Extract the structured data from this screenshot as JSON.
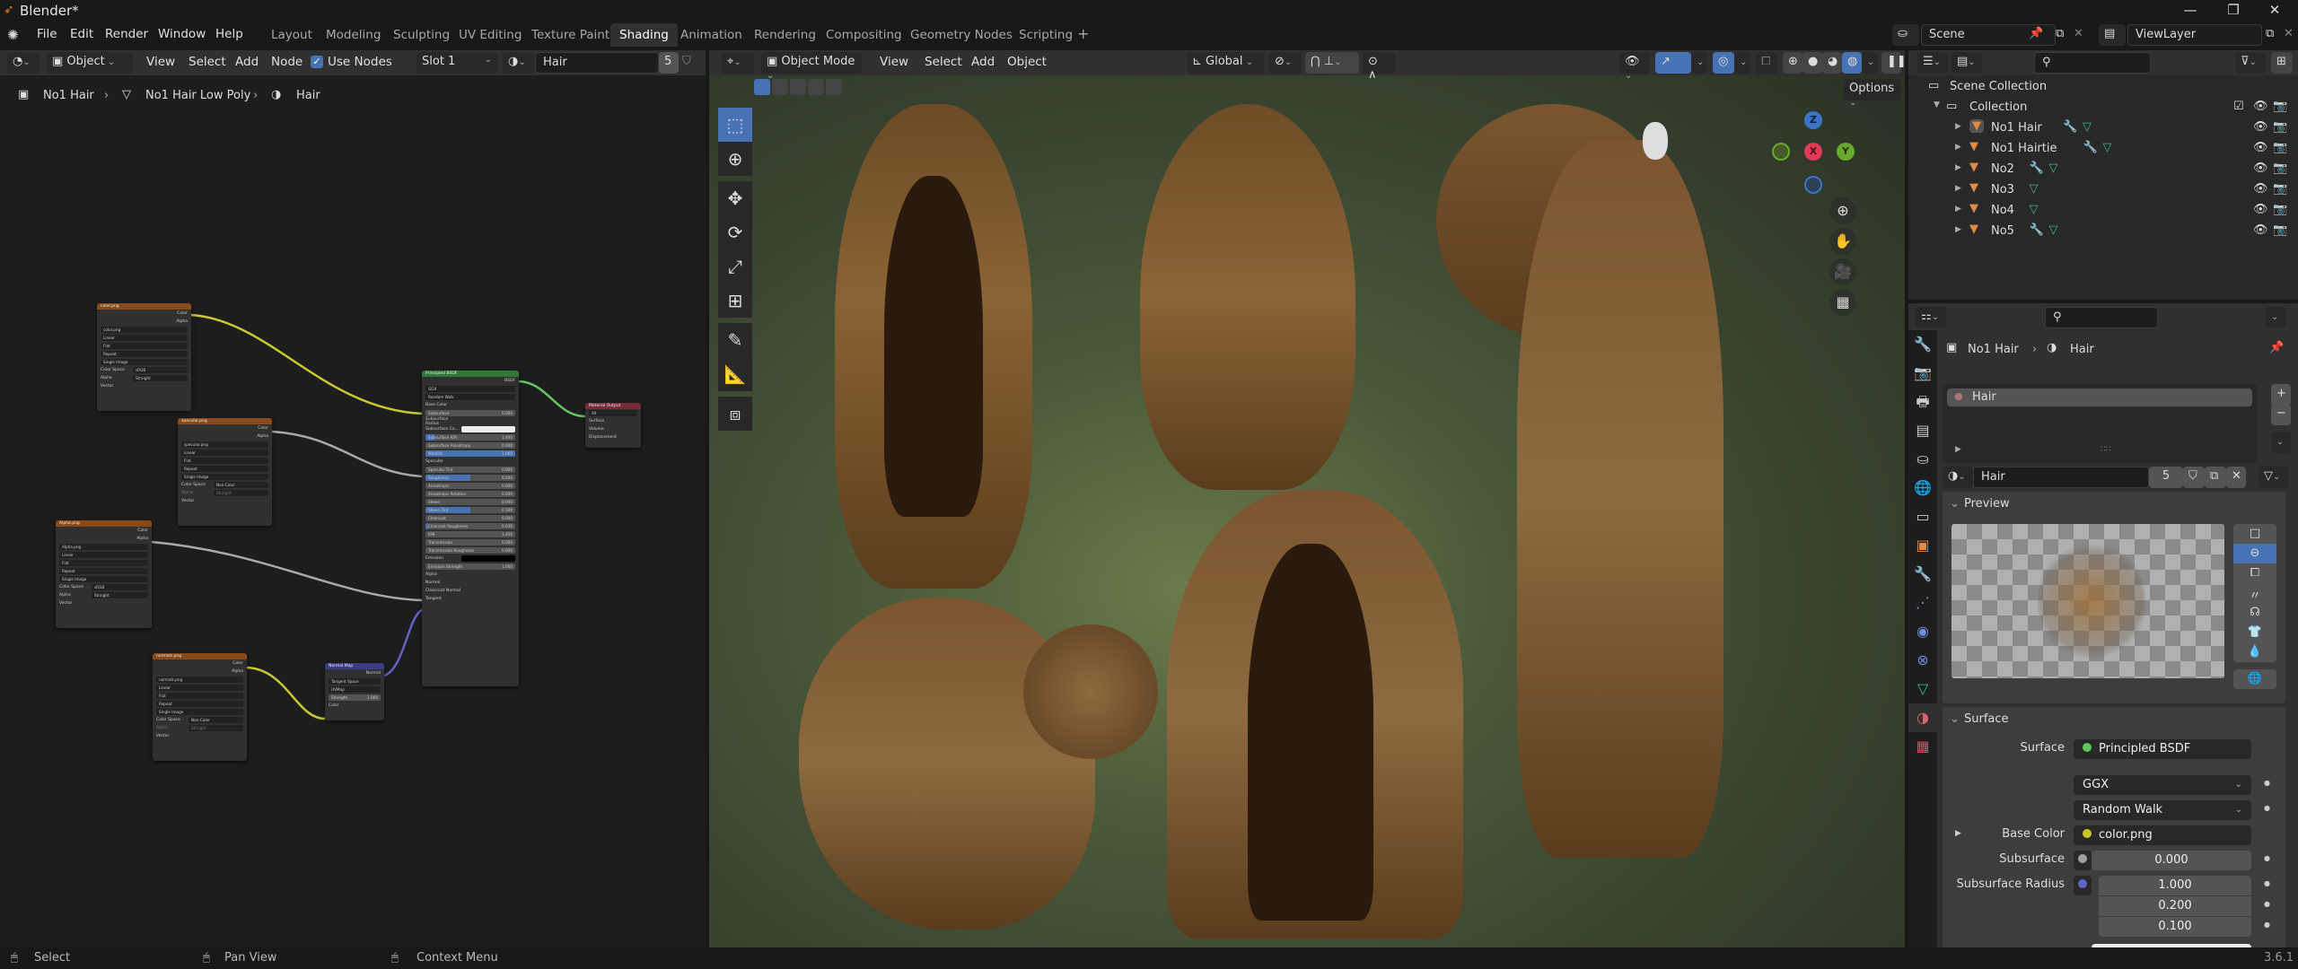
{
  "window": {
    "title": "Blender*",
    "controls": {
      "minimize": "—",
      "maximize": "❐",
      "close": "✕"
    }
  },
  "menubar": {
    "menus": [
      "File",
      "Edit",
      "Render",
      "Window",
      "Help"
    ],
    "workspaces": [
      "Layout",
      "Modeling",
      "Sculpting",
      "UV Editing",
      "Texture Paint",
      "Shading",
      "Animation",
      "Rendering",
      "Compositing",
      "Geometry Nodes",
      "Scripting"
    ],
    "active_workspace": "Shading",
    "add_workspace": "+",
    "scene": {
      "label": "Scene"
    },
    "view_layer": {
      "label": "ViewLayer"
    }
  },
  "node_editor": {
    "header": {
      "object_type": "Object",
      "menus": [
        "View",
        "Select",
        "Add",
        "Node"
      ],
      "use_nodes_label": "Use Nodes",
      "use_nodes_checked": true,
      "slot": "Slot 1",
      "material": "Hair",
      "users": "5"
    },
    "breadcrumb": [
      "No1 Hair",
      "No1 Hair Low Poly",
      "Hair"
    ],
    "nodes": {
      "color": {
        "title": "color.png",
        "outputs": [
          "Color",
          "Alpha"
        ],
        "image": "color.png",
        "interp": "Linear",
        "proj": "Flat",
        "ext": "Repeat",
        "source": "Single Image",
        "cs_label": "Color Space",
        "cs": "sRGB",
        "alpha_label": "Alpha",
        "alpha": "Straight",
        "input": "Vector"
      },
      "specular": {
        "title": "specular.png",
        "outputs": [
          "Color",
          "Alpha"
        ],
        "image": "specular.png",
        "interp": "Linear",
        "proj": "Flat",
        "ext": "Repeat",
        "source": "Single Image",
        "cs_label": "Color Space",
        "cs": "Non-Color",
        "alpha_label": "Alpha",
        "alpha": "Straight",
        "input": "Vector"
      },
      "alpha": {
        "title": "Alpha.png",
        "outputs": [
          "Color",
          "Alpha"
        ],
        "image": "Alpha.png",
        "interp": "Linear",
        "proj": "Flat",
        "ext": "Repeat",
        "source": "Single Image",
        "cs_label": "Color Space",
        "cs": "sRGB",
        "alpha_label": "Alpha",
        "alpha": "Straight",
        "input": "Vector"
      },
      "normals": {
        "title": "normals.png",
        "outputs": [
          "Color",
          "Alpha"
        ],
        "image": "normals.png",
        "interp": "Linear",
        "proj": "Flat",
        "ext": "Repeat",
        "source": "Single Image",
        "cs_label": "Color Space",
        "cs": "Non-Color",
        "alpha_label": "Alpha",
        "alpha": "Straight",
        "input": "Vector"
      },
      "normal_map": {
        "title": "Normal Map",
        "output": "Normal",
        "space": "Tangent Space",
        "uv": "UVMap",
        "strength_label": "Strength",
        "strength": "1.000",
        "input": "Color"
      },
      "bsdf": {
        "title": "Principled BSDF",
        "output": "BSDF",
        "dist": "GGX",
        "sss": "Random Walk",
        "rows": [
          {
            "label": "Base Color",
            "type": "socket"
          },
          {
            "label": "Subsurface",
            "value": "0.000"
          },
          {
            "label": "Subsurface Radius",
            "type": "drop"
          },
          {
            "label": "Subsurface Co...",
            "type": "color-white"
          },
          {
            "label": "Subsurface IOR",
            "value": "1.400",
            "fill": 0.1
          },
          {
            "label": "Subsurface Anisotropy",
            "value": "0.000"
          },
          {
            "label": "Metallic",
            "value": "1.000",
            "fill": 1.0
          },
          {
            "label": "Specular",
            "type": "socket"
          },
          {
            "label": "Specular Tint",
            "value": "0.000"
          },
          {
            "label": "Roughness",
            "value": "0.500",
            "fill": 0.5
          },
          {
            "label": "Anisotropic",
            "value": "0.000"
          },
          {
            "label": "Anisotropic Rotation",
            "value": "0.000"
          },
          {
            "label": "Sheen",
            "value": "0.000"
          },
          {
            "label": "Sheen Tint",
            "value": "0.500",
            "fill": 0.5
          },
          {
            "label": "Clearcoat",
            "value": "0.000"
          },
          {
            "label": "Clearcoat Roughness",
            "value": "0.030",
            "fill": 0.03
          },
          {
            "label": "IOR",
            "value": "1.450"
          },
          {
            "label": "Transmission",
            "value": "0.000"
          },
          {
            "label": "Transmission Roughness",
            "value": "0.000"
          },
          {
            "label": "Emission",
            "type": "color-black"
          },
          {
            "label": "Emission Strength",
            "value": "1.000"
          },
          {
            "label": "Alpha",
            "type": "socket"
          },
          {
            "label": "Normal",
            "type": "socket"
          },
          {
            "label": "Clearcoat Normal",
            "type": "socket"
          },
          {
            "label": "Tangent",
            "type": "socket"
          }
        ]
      },
      "output": {
        "title": "Material Output",
        "target": "All",
        "inputs": [
          "Surface",
          "Volume",
          "Displacement"
        ]
      }
    }
  },
  "viewport": {
    "header": {
      "mode": "Object Mode",
      "menus": [
        "View",
        "Select",
        "Add",
        "Object"
      ],
      "orientation": "Global"
    },
    "options_label": "Options",
    "gizmo": {
      "x": "X",
      "y": "Y",
      "z": "Z"
    },
    "tools": [
      "select-box",
      "cursor",
      "move",
      "rotate",
      "scale",
      "transform",
      "annotate",
      "measure",
      "add-cube"
    ]
  },
  "outliner": {
    "root": "Scene Collection",
    "collection": "Collection",
    "items": [
      {
        "name": "No1 Hair",
        "modifier": true,
        "active": true
      },
      {
        "name": "No1 Hairtie",
        "modifier": true
      },
      {
        "name": "No2",
        "modifier": true
      },
      {
        "name": "No3",
        "modifier": false
      },
      {
        "name": "No4",
        "modifier": false
      },
      {
        "name": "No5",
        "modifier": true
      }
    ]
  },
  "properties": {
    "breadcrumb": [
      "No1 Hair",
      "Hair"
    ],
    "slot_item": "Hair",
    "material_name": "Hair",
    "users": "5",
    "preview_label": "Preview",
    "surface_label": "Surface",
    "fields": {
      "surface_label": "Surface",
      "surface_value": "Principled BSDF",
      "distribution": "GGX",
      "sss_method": "Random Walk",
      "base_color_label": "Base Color",
      "base_color_value": "color.png",
      "subsurface_label": "Subsurface",
      "subsurface_value": "0.000",
      "radius_label": "Subsurface Radius",
      "radius": [
        "1.000",
        "0.200",
        "0.100"
      ]
    }
  },
  "statusbar": {
    "hints": [
      "Select",
      "Pan View",
      "Context Menu"
    ],
    "version": "3.6.1"
  },
  "colors": {
    "accent": "#4772b3",
    "object": "#e08b43",
    "mesh": "#3bba7f",
    "modifier": "#6e8fdb"
  }
}
